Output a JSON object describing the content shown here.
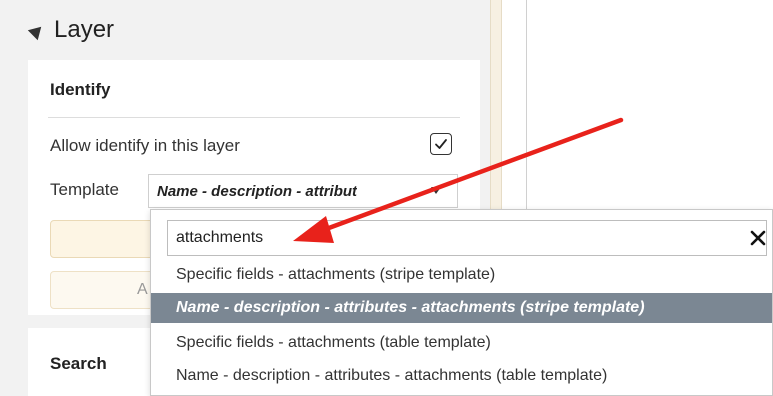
{
  "layer": {
    "title": "Layer"
  },
  "identify": {
    "title": "Identify",
    "allow_label": "Allow identify in this layer",
    "allow_checked": true,
    "template_label": "Template",
    "template_value": "Name - description - attribut"
  },
  "button_fragment": "A",
  "search": {
    "title": "Search"
  },
  "dropdown": {
    "search_value": "attachments",
    "items": [
      {
        "label": "Specific fields - attachments (stripe template)",
        "selected": false
      },
      {
        "label": "Name - description - attributes - attachments (stripe template)",
        "selected": true
      },
      {
        "label": "Specific fields - attachments (table template)",
        "selected": false
      },
      {
        "label": "Name - description - attributes - attachments (table template)",
        "selected": false
      }
    ]
  },
  "colors": {
    "panel_bg": "#f2f2f2",
    "selected_bg": "#7b8793",
    "arrow": "#e8221b",
    "beige": "#fdf5e4"
  },
  "icons": [
    "collapse-triangle-icon",
    "checkmark-icon",
    "caret-down-icon",
    "close-icon",
    "red-arrow-annotation"
  ]
}
